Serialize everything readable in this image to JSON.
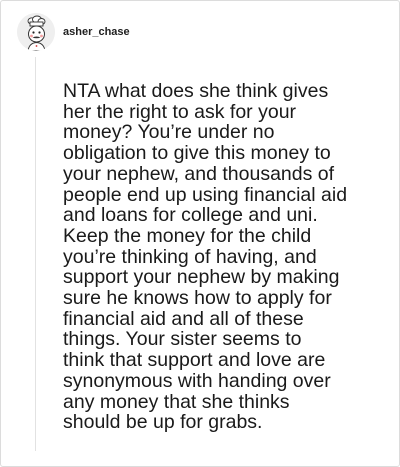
{
  "comment": {
    "author": {
      "username": "asher_chase",
      "avatar_icon": "cartoon-chef-avatar-icon"
    },
    "body": "NTA what does she think gives\nher the right to ask for your\nmoney? You’re under no\nobligation to give this money to\nyour nephew, and thousands of\npeople end up using financial aid\nand loans for college and uni.\nKeep the money for the child\nyou’re thinking of having, and\nsupport your nephew by making\nsure he knows how to apply for\nfinancial aid and all of these\nthings. Your sister seems to\nthink that support and love are\nsynonymous with handing over\nany money that she thinks\nshould be up for grabs."
  },
  "colors": {
    "border": "#dcdcdc",
    "thread_line": "#e2e2e2",
    "text": "#1a1a1a"
  }
}
